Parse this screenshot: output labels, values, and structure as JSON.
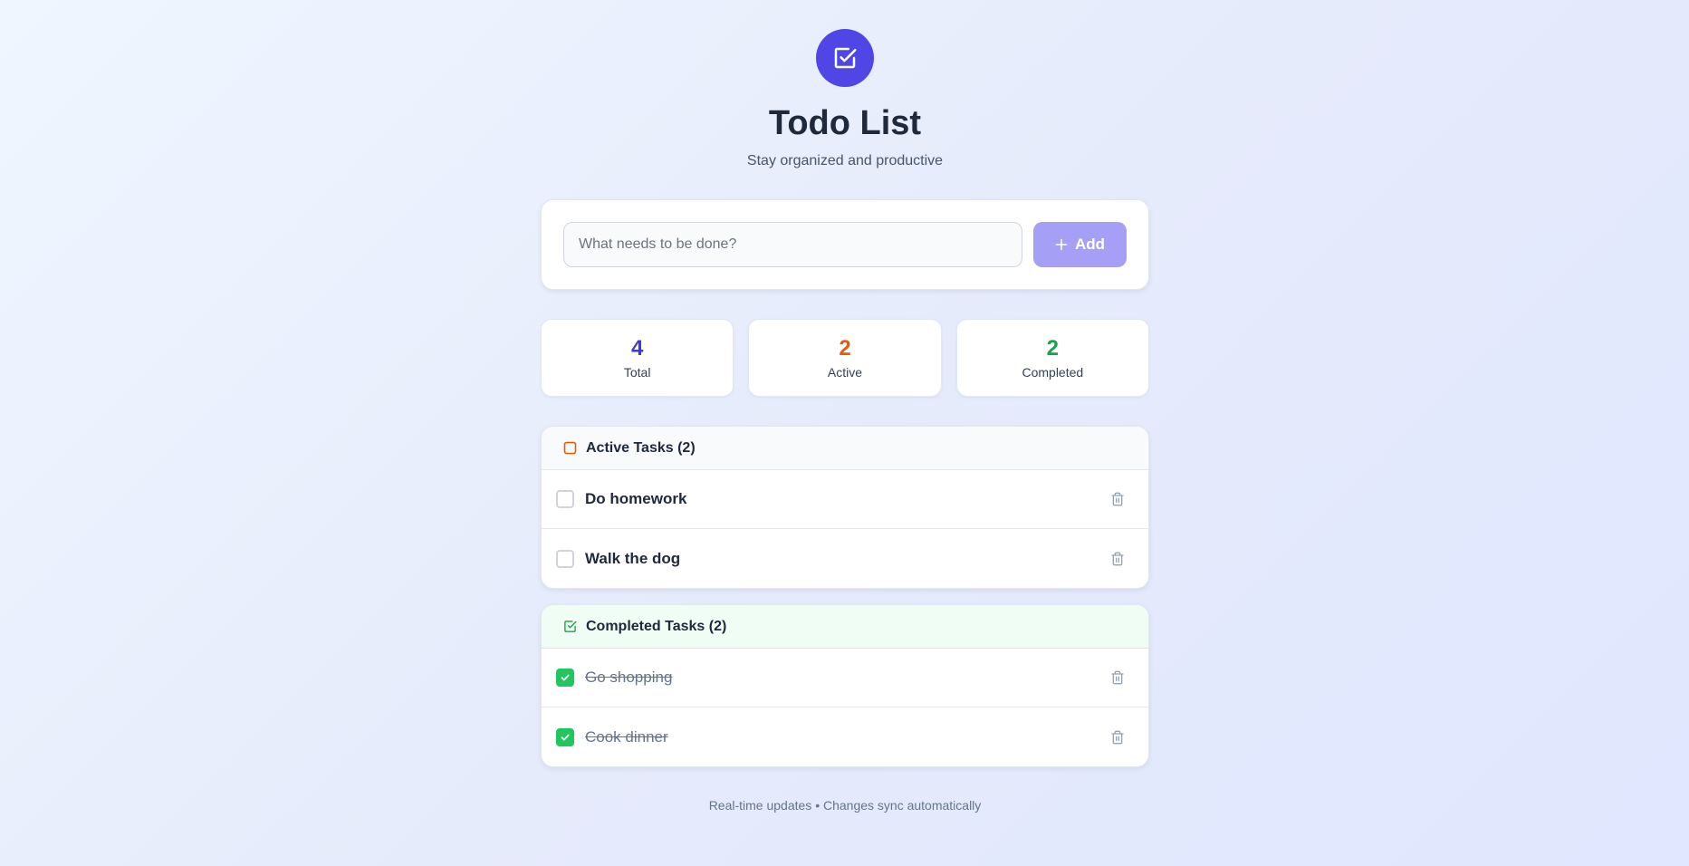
{
  "header": {
    "logo_icon": "checkbox-square-icon",
    "title": "Todo List",
    "subtitle": "Stay organized and productive"
  },
  "add_form": {
    "input_value": "",
    "placeholder": "What needs to be done?",
    "button_icon": "plus-icon",
    "button_label": "Add"
  },
  "stats": [
    {
      "value": "4",
      "label": "Total",
      "color": "#4338ca"
    },
    {
      "value": "2",
      "label": "Active",
      "color": "#ea580c"
    },
    {
      "value": "2",
      "label": "Completed",
      "color": "#16a34a"
    }
  ],
  "active_section": {
    "icon": "square-icon",
    "title": "Active Tasks (2)",
    "tasks": [
      {
        "text": "Do homework",
        "completed": false
      },
      {
        "text": "Walk the dog",
        "completed": false
      }
    ]
  },
  "completed_section": {
    "icon": "check-square-icon",
    "title": "Completed Tasks (2)",
    "tasks": [
      {
        "text": "Go shopping",
        "completed": true
      },
      {
        "text": "Cook dinner",
        "completed": true
      }
    ]
  },
  "footer": {
    "text": "Real-time updates • Changes sync automatically"
  },
  "colors": {
    "brand": "#4f46e5",
    "add_button": "#a5a0f5",
    "active_accent": "#ea580c",
    "completed_accent": "#22c55e"
  }
}
